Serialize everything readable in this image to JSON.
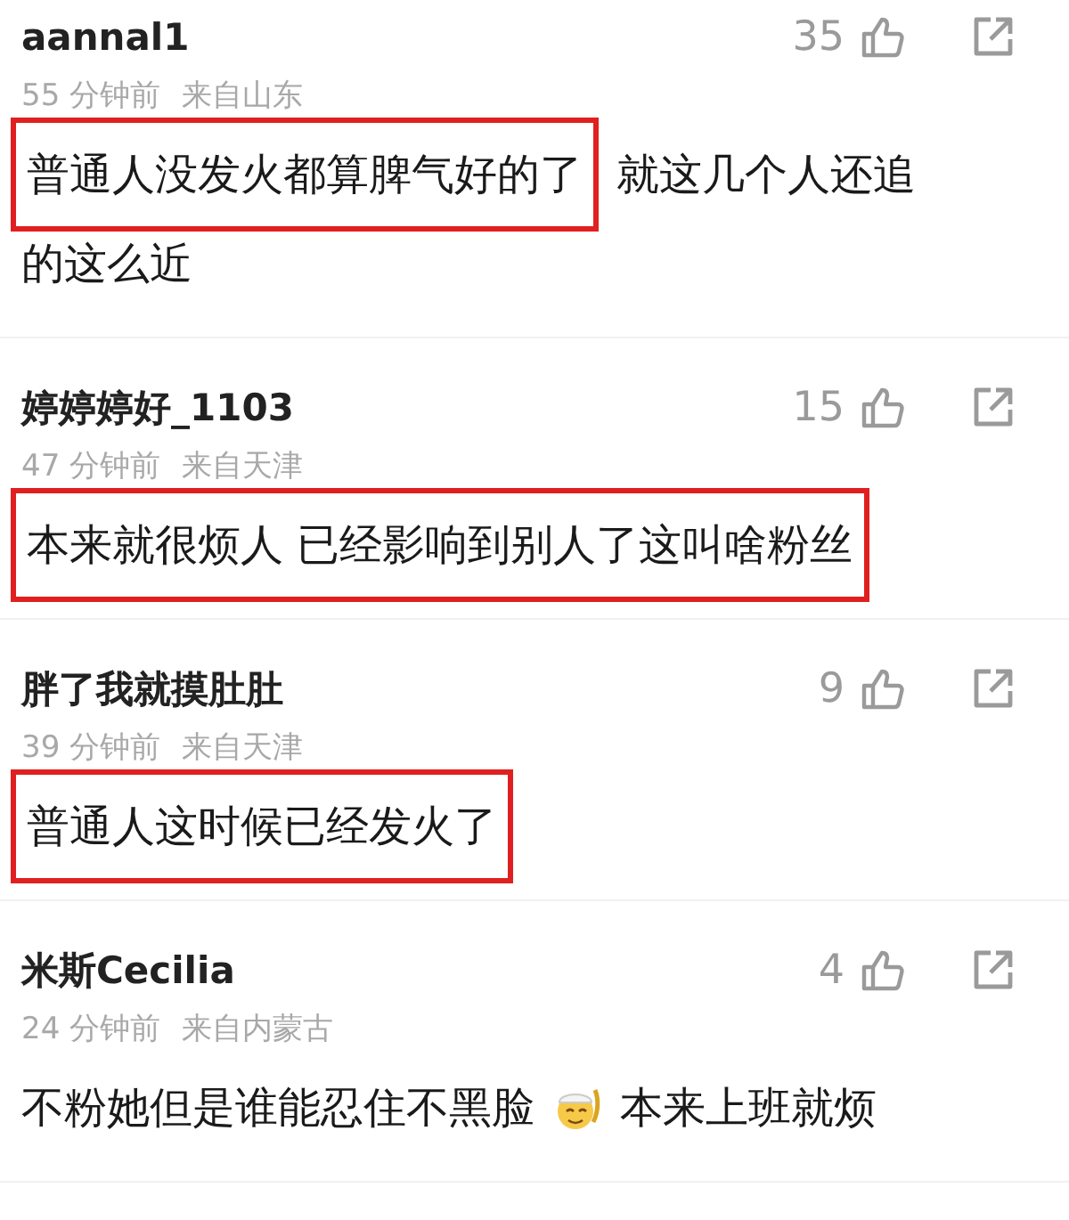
{
  "comments": [
    {
      "user": "aannal1",
      "likes": "35",
      "time": "55 分钟前",
      "place": "来自山东",
      "lines": [
        [
          {
            "kind": "text",
            "text": "普通人没发火都算脾气好的了",
            "highlighted": true
          },
          {
            "kind": "text",
            "text": "就这几个人还追",
            "highlighted": false
          }
        ],
        [
          {
            "kind": "text",
            "text": "的这么近",
            "highlighted": false
          }
        ]
      ]
    },
    {
      "user": "婷婷婷好_1103",
      "likes": "15",
      "time": "47 分钟前",
      "place": "来自天津",
      "lines": [
        [
          {
            "kind": "text",
            "text": "本来就很烦人 已经影响到别人了这叫啥粉丝",
            "highlighted": true
          }
        ]
      ]
    },
    {
      "user": "胖了我就摸肚肚",
      "likes": "9",
      "time": "39 分钟前",
      "place": "来自天津",
      "lines": [
        [
          {
            "kind": "text",
            "text": "普通人这时候已经发火了",
            "highlighted": true
          }
        ]
      ]
    },
    {
      "user": "米斯Cecilia",
      "likes": "4",
      "time": "24 分钟前",
      "place": "来自内蒙古",
      "lines": [
        [
          {
            "kind": "text",
            "text": "不粉她但是谁能忍住不黑脸",
            "highlighted": false
          },
          {
            "kind": "emoji"
          },
          {
            "kind": "text",
            "text": "本来上班就烦",
            "highlighted": false
          }
        ]
      ]
    }
  ]
}
